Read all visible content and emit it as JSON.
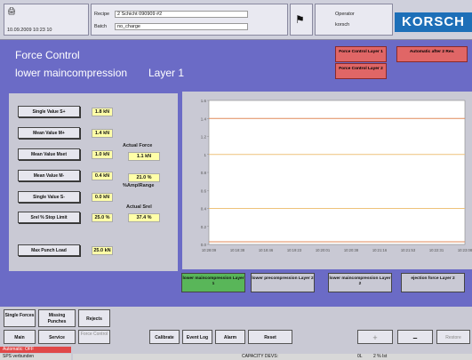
{
  "header": {
    "datetime": "10.09.2009 10:23 10",
    "recipe_label": "Recipe",
    "recipe_value": "2 Schicht 090909 #2",
    "batch_label": "Batch",
    "batch_value": "no_charge",
    "operator_label": "Operator",
    "operator_value": "korsch",
    "logo_text": "KORSCH",
    "brand_color": "#1d6fb8"
  },
  "panel": {
    "title": "Force Control",
    "subtitle": "lower maincompression",
    "layer": "Layer 1",
    "quick_buttons": [
      {
        "label": "Force Control Layer 1"
      },
      {
        "label": "Automatic after 2 Rev."
      },
      {
        "label": "Force Control Layer 2"
      }
    ]
  },
  "values": {
    "rows": [
      {
        "label": "Single Value S+",
        "value": "1.8 kN"
      },
      {
        "label": "Mean Value M+",
        "value": "1.4 kN"
      },
      {
        "label": "Mean Value Mset",
        "value": "1.0 kN"
      },
      {
        "label": "Mean Value M-",
        "value": "0.4 kN"
      },
      {
        "label": "Single Value S-",
        "value": "0.0 kN"
      },
      {
        "label": "Srel % Stop Limit",
        "value": "25.0 %"
      }
    ],
    "max_punch_label": "Max Punch Load",
    "max_punch_value": "25.0 kN",
    "actual_force_label": "Actual Force",
    "actual_force_value": "1.1 kN",
    "amp_value": "21.0 %",
    "amp_label": "%AmplRange",
    "actual_srel_label": "Actual Srel",
    "actual_srel_value": "37.4 %"
  },
  "tabs": [
    {
      "label": "lower maincompression Layer 1",
      "active": true
    },
    {
      "label": "lower precompression Layer 2",
      "active": false
    },
    {
      "label": "lower maincompression Layer 2",
      "active": false
    },
    {
      "label": "ejection force Layer 2",
      "active": false
    }
  ],
  "bottom": {
    "row1": [
      "Single Forces",
      "Missing Punches",
      "Rejects"
    ],
    "row2": [
      "Main",
      "Service",
      "Force Control"
    ],
    "row2b": [
      "Calibrate",
      "Event Log",
      "Alarm",
      "Reset"
    ],
    "plus": "+",
    "minus": "–",
    "restore": "Restore",
    "status_automatic": "Automatic: OFF",
    "status_sps": "SPS verbunden",
    "capacity_label": "CAPACITY DEVS:",
    "capacity_unit": "0L",
    "capacity_value": "2 % Ist"
  },
  "chart_data": {
    "type": "line",
    "x": [
      "10:28:09",
      "10:18:38",
      "10:18:46",
      "10:19:23",
      "10:20:01",
      "10:20:38",
      "10:21:16",
      "10:21:53",
      "10:22:31",
      "10:23:08"
    ],
    "y_ticks": [
      "1.6",
      "1.4",
      "1.2",
      "1",
      "0.8",
      "0.6",
      "0.4",
      "0.2",
      "0.0"
    ],
    "ylim": [
      0,
      1.6
    ],
    "series": [
      {
        "values": [
          1.4,
          1.4,
          1.4,
          1.4,
          1.4,
          1.4,
          1.4,
          1.4,
          1.4,
          1.4
        ],
        "color": "#e08a5a"
      },
      {
        "values": [
          1.0,
          1.0,
          1.0,
          1.0,
          1.0,
          1.0,
          1.0,
          1.0,
          1.0,
          1.0
        ],
        "color": "#eec27a"
      },
      {
        "values": [
          0.4,
          0.4,
          0.4,
          0.4,
          0.4,
          0.4,
          0.4,
          0.4,
          0.4,
          0.4
        ],
        "color": "#eec27a"
      },
      {
        "values": [
          0.03,
          0.03,
          0.03,
          0.03,
          0.03,
          0.03,
          0.03,
          0.03,
          0.03,
          0.03
        ],
        "color": "#e08a5a"
      }
    ],
    "grid": false
  }
}
